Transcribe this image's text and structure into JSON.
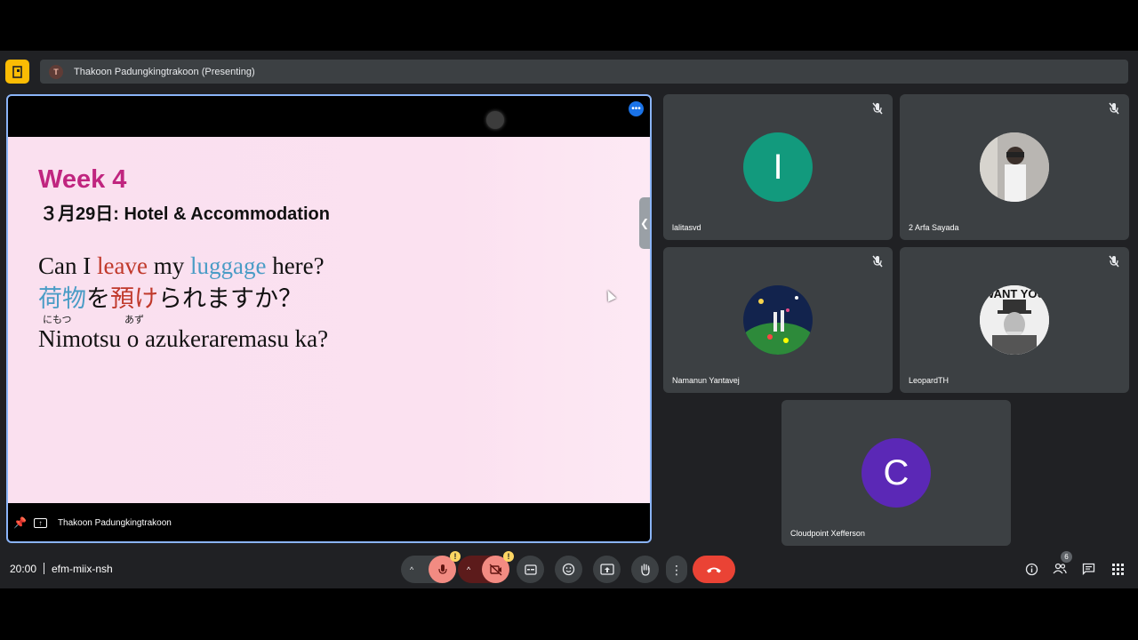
{
  "presenter_bar": {
    "avatar_letter": "T",
    "label": "Thakoon Padungkingtrakoon (Presenting)"
  },
  "presentation": {
    "slide": {
      "week": "Week 4",
      "subtitle": "３月29日: Hotel & Accommodation",
      "en_1": "Can I ",
      "en_leave": "leave",
      "en_2": " my ",
      "en_luggage": "luggage",
      "en_3": " here?",
      "jp_nimotsu": "荷物",
      "jp_wo": "を",
      "jp_azuke": "預け",
      "jp_rest": "られますか？",
      "ruby_nimotsu": "にもつ",
      "ruby_azu": "あず",
      "romaji": "Nimotsu o azukeraremasu ka?"
    },
    "footer_name": "Thakoon Padungkingtrakoon"
  },
  "participants": [
    {
      "name": "lalitasvd",
      "initial": "I",
      "color": "#129a7d"
    },
    {
      "name": "2 Arfa Sayada",
      "initial": "",
      "color": "#cfcfcf"
    },
    {
      "name": "Namanun Yantavej",
      "initial": "",
      "color": "#1a3a6a"
    },
    {
      "name": "LeopardTH",
      "initial": "",
      "color": "#ddd",
      "photo_text": "WANT YOU"
    },
    {
      "name": "Cloudpoint Xefferson",
      "initial": "C",
      "color": "#5b28b6"
    }
  ],
  "bottom_bar": {
    "time": "20:00",
    "meeting_code": "efm-miix-nsh",
    "people_count": "6"
  },
  "colors": {
    "accent_blue": "#8ab4f8",
    "end_call_red": "#ea4335",
    "muted_red": "#f28b82"
  }
}
